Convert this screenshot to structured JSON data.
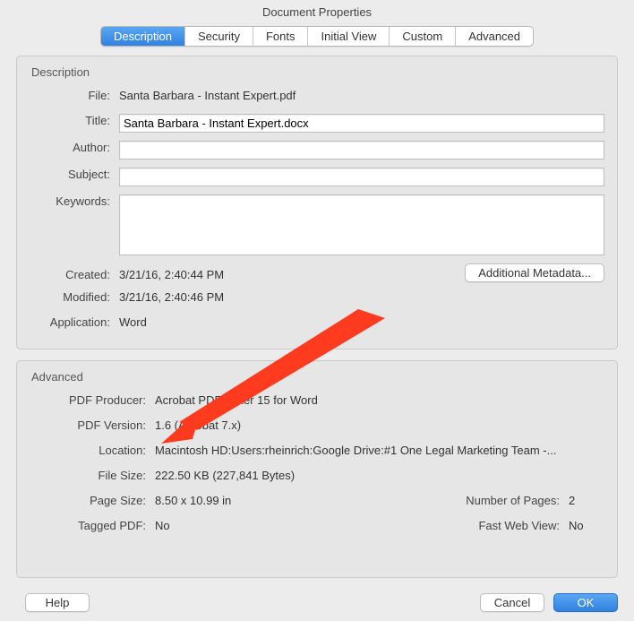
{
  "window": {
    "title": "Document Properties"
  },
  "tabs": [
    {
      "label": "Description",
      "active": true
    },
    {
      "label": "Security",
      "active": false
    },
    {
      "label": "Fonts",
      "active": false
    },
    {
      "label": "Initial View",
      "active": false
    },
    {
      "label": "Custom",
      "active": false
    },
    {
      "label": "Advanced",
      "active": false
    }
  ],
  "description": {
    "heading": "Description",
    "labels": {
      "file": "File:",
      "title": "Title:",
      "author": "Author:",
      "subject": "Subject:",
      "keywords": "Keywords:",
      "created": "Created:",
      "modified": "Modified:",
      "application": "Application:"
    },
    "file": "Santa Barbara - Instant Expert.pdf",
    "title": "Santa Barbara - Instant Expert.docx",
    "author": "",
    "subject": "",
    "keywords": "",
    "created": "3/21/16, 2:40:44 PM",
    "modified": "3/21/16, 2:40:46 PM",
    "application": "Word",
    "additional_metadata_btn": "Additional Metadata..."
  },
  "advanced": {
    "heading": "Advanced",
    "labels": {
      "pdf_producer": "PDF Producer:",
      "pdf_version": "PDF Version:",
      "location": "Location:",
      "file_size": "File Size:",
      "page_size": "Page Size:",
      "number_of_pages": "Number of Pages:",
      "tagged_pdf": "Tagged PDF:",
      "fast_web_view": "Fast Web View:"
    },
    "pdf_producer": "Acrobat PDFMaker 15 for Word",
    "pdf_version": "1.6 (Acrobat 7.x)",
    "location": "Macintosh HD:Users:rheinrich:Google Drive:#1 One Legal Marketing Team -...",
    "file_size": "222.50 KB (227,841 Bytes)",
    "page_size": "8.50 x 10.99 in",
    "number_of_pages": "2",
    "tagged_pdf": "No",
    "fast_web_view": "No"
  },
  "footer": {
    "help": "Help",
    "cancel": "Cancel",
    "ok": "OK"
  },
  "annotation": {
    "arrow_color": "#ff3b1f",
    "target": "file_size"
  }
}
